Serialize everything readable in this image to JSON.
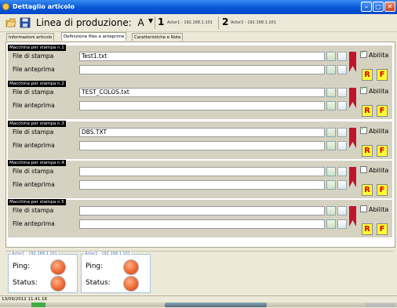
{
  "window": {
    "title": "Dettaglio articolo",
    "minimize": "–",
    "maximize": "□",
    "close": "✕"
  },
  "toolbar": {
    "linea_label": "Linea di produzione:",
    "linea_value": "A",
    "combo_arrow": "▼",
    "actors": [
      {
        "num": "1",
        "label": "Actor1 - 192.168.1.101"
      },
      {
        "num": "2",
        "label": "Actor2 - 192.168.1.101"
      }
    ]
  },
  "tabs": [
    {
      "label": "Informazioni articolo",
      "active": false
    },
    {
      "label": "Definizione files e anteprime",
      "active": true
    },
    {
      "label": "Caratteristiche e Note",
      "active": false
    }
  ],
  "field_labels": {
    "stampa": "File di stampa",
    "anteprima": "File anteprima",
    "abilita": "Abilita",
    "r": "R",
    "f": "F"
  },
  "machines": [
    {
      "title": "Macchina per stampa n.1",
      "stampa_value": "Test1.txt",
      "anteprima_value": "",
      "abilita_checked": true
    },
    {
      "title": "Macchina per stampa n.2",
      "stampa_value": "TEST_COLOS.txt",
      "anteprima_value": "",
      "abilita_checked": true
    },
    {
      "title": "Macchina per stampa n.3",
      "stampa_value": "DBS.TXT",
      "anteprima_value": "",
      "abilita_checked": true
    },
    {
      "title": "Macchina per stampa n.4",
      "stampa_value": "",
      "anteprima_value": "",
      "abilita_checked": false
    },
    {
      "title": "Macchina per stampa n.5",
      "stampa_value": "",
      "anteprima_value": "",
      "abilita_checked": false
    }
  ],
  "actor_status": [
    {
      "title": "Actor1 - 192.168.1.101",
      "ping_label": "Ping:",
      "status_label": "Status:"
    },
    {
      "title": "Actor2 - 192.168.1.101",
      "ping_label": "Ping:",
      "status_label": "Status:"
    }
  ],
  "footer": {
    "timestamp": "13/09/2012 11.41.16"
  },
  "colors": {
    "titlebar": "#0a5ad8",
    "machine_bg": "#d6d2c2",
    "rf_button_bg": "#ffff33",
    "rf_button_text": "#dd0000",
    "led": "#ee6a35"
  }
}
